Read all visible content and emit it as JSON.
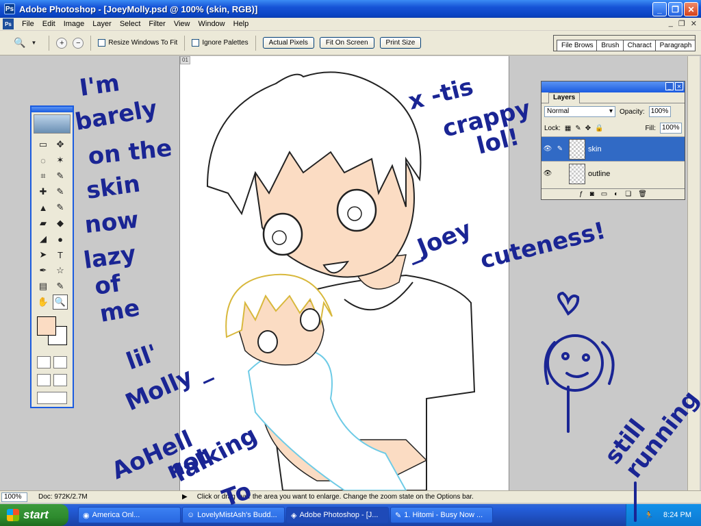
{
  "window": {
    "title": "Adobe Photoshop - [JoeyMolly.psd @ 100% (skin, RGB)]",
    "minimize": "_",
    "restore": "❐",
    "close": "✕"
  },
  "menu": {
    "items": [
      "File",
      "Edit",
      "Image",
      "Layer",
      "Select",
      "Filter",
      "View",
      "Window",
      "Help"
    ],
    "doc_minimize": "_",
    "doc_restore": "❐",
    "doc_close": "✕"
  },
  "options": {
    "resize_windows": "Resize Windows To Fit",
    "ignore_palettes": "Ignore Palettes",
    "actual_pixels": "Actual Pixels",
    "fit_on_screen": "Fit On Screen",
    "print_size": "Print Size",
    "palette_tabs": [
      "File Brows",
      "Brush",
      "Charact",
      "Paragraph"
    ]
  },
  "document": {
    "tab_label": "01"
  },
  "toolbox": {
    "tools": [
      "▭",
      "✥",
      "◌",
      "✶",
      "⌗",
      "✎",
      "✚",
      "✎",
      "▲",
      "✎",
      "▰",
      "◆",
      "◢",
      "●",
      "➤",
      "T",
      "✒",
      "☆",
      "▤",
      "✎",
      "✋",
      "🔍"
    ],
    "fg_color": "#fbdcc3",
    "bg_color": "#ffffff"
  },
  "layers": {
    "tab": "Layers",
    "blend_mode": "Normal",
    "opacity_label": "Opacity:",
    "opacity_value": "100%",
    "lock_label": "Lock:",
    "fill_label": "Fill:",
    "fill_value": "100%",
    "items": [
      {
        "name": "skin",
        "selected": true
      },
      {
        "name": "outline",
        "selected": false
      }
    ]
  },
  "statusbar": {
    "zoom": "100%",
    "doc": "Doc: 972K/2.7M",
    "message": "Click or drag over the area you want to enlarge. Change the zoom state on the Options bar."
  },
  "taskbar": {
    "start": "start",
    "tasks": [
      "America Onl...",
      "LovelyMistAsh's Budd...",
      "Adobe Photoshop - [J...",
      "1. Hitomi - Busy Now ..."
    ],
    "clock": "8:24 PM"
  },
  "scribbles": {
    "left": [
      "I'm",
      "barely",
      "on the",
      "skin",
      "now",
      "lazy",
      "of",
      "me"
    ],
    "top_right": [
      "x -tis",
      "crappy",
      "lol!"
    ],
    "joey": "_Joey",
    "cuteness": "cuteness!",
    "molly": [
      "lil'",
      "Molly _"
    ],
    "bottom": [
      "AoHell",
      "not",
      "falking",
      "To"
    ],
    "still": [
      "still",
      "running"
    ]
  }
}
